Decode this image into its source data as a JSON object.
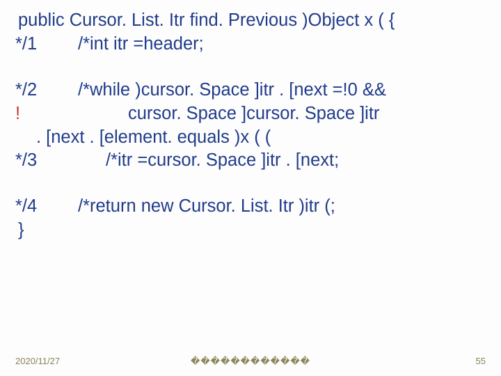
{
  "code": {
    "l1_full": "public Cursor. List. Itr find. Previous )Object x ( {",
    "l2_lbl": "*/1",
    "l2_txt": "/*int itr  =header;",
    "l3_lbl": "*/2",
    "l3_txt": "/*while )cursor. Space ]itr . [next  =!0 &&",
    "l4_bang": "!",
    "l4_indent_txt": "cursor. Space ]cursor. Space ]itr",
    "l5_txt": " . [next . [element. equals )x ( (",
    "l6_lbl": "*/3",
    "l6_txt": "/*itr  =cursor. Space ]itr . [next;",
    "l7_lbl": "*/4",
    "l7_txt": "/*return new Cursor. List. Itr )itr (;",
    "l8_full": "}"
  },
  "footer": {
    "date": "2020/11/27",
    "center": "������������",
    "pagenum": "55"
  }
}
